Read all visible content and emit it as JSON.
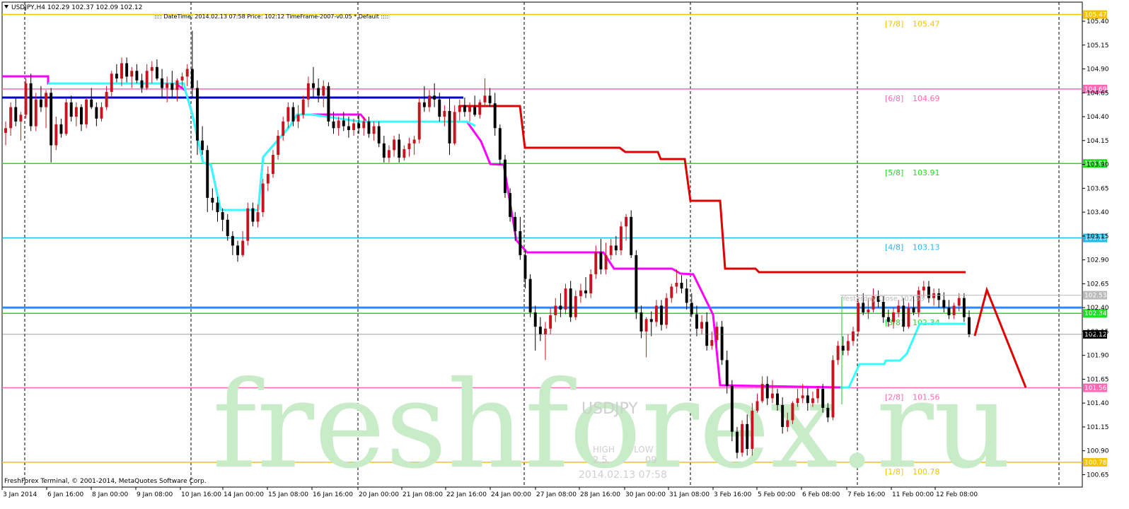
{
  "window": {
    "header": "USDJPY,H4  102.29 102.37 102.09 102.12",
    "indicator_line": ":::: DateTime: 2014.02.13 07:58    Price: 102:12    TimeFrame-2007-v0.05    *  Default    ::::",
    "copyright": "FreshForex Terminal, © 2001-2014, MetaQuotes Software Corp."
  },
  "watermark": {
    "brand": "freshforex.ru",
    "symbol": "USDJPY",
    "high_label": "HIGH",
    "low_label": "LOW",
    "high_value": "2.5",
    "low_value": "09",
    "datetime": "2014.02.13 07:58"
  },
  "colors": {
    "bull": "#c8141e",
    "bear": "#000000",
    "murrey_yellow": "#f5c400",
    "murrey_pink": "#ff69b4",
    "murrey_green": "#22dd22",
    "murrey_cyan": "#22b8e8",
    "magenta_line": "#ff00ff",
    "cyan_line": "#33ffff",
    "red_line": "#e00000",
    "blue_line": "#0000cc",
    "arrow": "#e00000",
    "watermark": "#c8ecc8"
  },
  "chart_data": {
    "type": "candlestick",
    "symbol": "USDJPY",
    "timeframe": "H4",
    "ylim": [
      100.52,
      105.6
    ],
    "y_ticks": [
      105.4,
      105.15,
      104.9,
      104.65,
      104.4,
      104.15,
      103.9,
      103.65,
      103.4,
      103.15,
      102.9,
      102.65,
      102.4,
      102.15,
      101.9,
      101.65,
      101.4,
      101.15,
      100.9,
      100.65
    ],
    "x_ticks": [
      "3 Jan 2014",
      "6 Jan 16:00",
      "8 Jan 00:00",
      "9 Jan 08:00",
      "10 Jan 16:00",
      "14 Jan 00:00",
      "15 Jan 08:00",
      "16 Jan 16:00",
      "20 Jan 00:00",
      "21 Jan 08:00",
      "22 Jan 16:00",
      "24 Jan 00:00",
      "27 Jan 08:00",
      "28 Jan 16:00",
      "30 Jan 00:00",
      "31 Jan 08:00",
      "3 Feb 16:00",
      "5 Feb 00:00",
      "6 Feb 08:00",
      "7 Feb 16:00",
      "11 Feb 00:00",
      "12 Feb 08:00"
    ],
    "current_price": "102.12",
    "murrey_levels": [
      {
        "label": "[7/8]",
        "value": "105.47",
        "color": "yellow"
      },
      {
        "label": "[6/8]",
        "value": "104.69",
        "color": "pink"
      },
      {
        "label": "[5/8]",
        "value": "103.91",
        "color": "green"
      },
      {
        "label": "[4/8]",
        "value": "103.13",
        "color": "cyan"
      },
      {
        "label": "[3/8]",
        "value": "102.34",
        "color": "green"
      },
      {
        "label": "[2/8]",
        "value": "101.56",
        "color": "pink"
      },
      {
        "label": "[1/8]",
        "value": "100.78",
        "color": "yellow"
      }
    ],
    "yesterday_close": {
      "label": "Yesterday Close 102.53",
      "value": "102.53"
    },
    "blue_line_value": 102.4,
    "upper_blue_value": 104.6,
    "candles": [
      [
        104.23,
        104.35,
        104.1,
        104.28
      ],
      [
        104.28,
        104.55,
        104.2,
        104.5
      ],
      [
        104.5,
        104.6,
        104.3,
        104.35
      ],
      [
        104.35,
        104.45,
        104.15,
        104.42
      ],
      [
        104.42,
        104.8,
        104.38,
        104.75
      ],
      [
        104.75,
        104.85,
        104.25,
        104.3
      ],
      [
        104.3,
        104.65,
        104.25,
        104.58
      ],
      [
        104.58,
        104.72,
        104.45,
        104.5
      ],
      [
        104.5,
        104.68,
        104.28,
        104.65
      ],
      [
        104.65,
        104.7,
        103.92,
        104.1
      ],
      [
        104.1,
        104.4,
        104.05,
        104.32
      ],
      [
        104.32,
        104.38,
        104.18,
        104.22
      ],
      [
        104.22,
        104.6,
        104.2,
        104.55
      ],
      [
        104.55,
        104.62,
        104.35,
        104.4
      ],
      [
        104.4,
        104.55,
        104.3,
        104.5
      ],
      [
        104.5,
        104.53,
        104.25,
        104.32
      ],
      [
        104.32,
        104.6,
        104.28,
        104.58
      ],
      [
        104.58,
        104.7,
        104.48,
        104.5
      ],
      [
        104.5,
        104.55,
        104.3,
        104.38
      ],
      [
        104.38,
        104.55,
        104.35,
        104.5
      ],
      [
        104.5,
        104.72,
        104.47,
        104.66
      ],
      [
        104.66,
        104.88,
        104.6,
        104.85
      ],
      [
        104.85,
        104.95,
        104.76,
        104.8
      ],
      [
        104.8,
        105.02,
        104.72,
        104.96
      ],
      [
        104.96,
        105.02,
        104.76,
        104.82
      ],
      [
        104.82,
        104.92,
        104.7,
        104.88
      ],
      [
        104.88,
        104.95,
        104.75,
        104.78
      ],
      [
        104.78,
        104.85,
        104.65,
        104.7
      ],
      [
        104.7,
        104.95,
        104.68,
        104.88
      ],
      [
        104.88,
        104.98,
        104.75,
        104.92
      ],
      [
        104.92,
        105.0,
        104.78,
        104.8
      ],
      [
        104.8,
        104.9,
        104.6,
        104.7
      ],
      [
        104.7,
        104.82,
        104.55,
        104.75
      ],
      [
        104.75,
        104.88,
        104.6,
        104.68
      ],
      [
        104.68,
        104.8,
        104.56,
        104.78
      ],
      [
        104.78,
        104.86,
        104.7,
        104.82
      ],
      [
        104.82,
        104.95,
        104.72,
        104.9
      ],
      [
        104.9,
        105.3,
        104.6,
        104.7
      ],
      [
        104.7,
        104.78,
        104.0,
        104.15
      ],
      [
        104.15,
        104.3,
        104.0,
        104.05
      ],
      [
        104.05,
        104.1,
        103.4,
        103.55
      ],
      [
        103.55,
        103.65,
        103.42,
        103.5
      ],
      [
        103.5,
        103.56,
        103.3,
        103.4
      ],
      [
        103.4,
        103.44,
        103.2,
        103.32
      ],
      [
        103.32,
        103.38,
        103.1,
        103.15
      ],
      [
        103.15,
        103.2,
        102.95,
        103.05
      ],
      [
        103.05,
        103.1,
        102.88,
        102.95
      ],
      [
        102.95,
        103.2,
        102.93,
        103.1
      ],
      [
        103.1,
        103.5,
        103.05,
        103.44
      ],
      [
        103.44,
        103.5,
        103.25,
        103.3
      ],
      [
        103.3,
        103.48,
        103.24,
        103.4
      ],
      [
        103.4,
        103.75,
        103.35,
        103.7
      ],
      [
        103.7,
        103.88,
        103.62,
        103.8
      ],
      [
        103.8,
        104.05,
        103.76,
        104.0
      ],
      [
        104.0,
        104.26,
        103.95,
        104.2
      ],
      [
        104.2,
        104.4,
        104.15,
        104.35
      ],
      [
        104.35,
        104.55,
        104.28,
        104.5
      ],
      [
        104.5,
        104.55,
        104.3,
        104.35
      ],
      [
        104.35,
        104.52,
        104.28,
        104.42
      ],
      [
        104.42,
        104.62,
        104.38,
        104.58
      ],
      [
        104.58,
        104.82,
        104.5,
        104.75
      ],
      [
        104.75,
        104.92,
        104.6,
        104.7
      ],
      [
        104.7,
        104.8,
        104.55,
        104.62
      ],
      [
        104.62,
        104.78,
        104.5,
        104.72
      ],
      [
        104.72,
        104.76,
        104.3,
        104.35
      ],
      [
        104.35,
        104.45,
        104.22,
        104.28
      ],
      [
        104.28,
        104.4,
        104.2,
        104.36
      ],
      [
        104.36,
        104.45,
        104.25,
        104.3
      ],
      [
        104.3,
        104.4,
        104.18,
        104.26
      ],
      [
        104.26,
        104.38,
        104.2,
        104.33
      ],
      [
        104.33,
        104.42,
        104.22,
        104.28
      ],
      [
        104.28,
        104.4,
        104.2,
        104.35
      ],
      [
        104.35,
        104.4,
        104.18,
        104.22
      ],
      [
        104.22,
        104.35,
        104.15,
        104.3
      ],
      [
        104.3,
        104.35,
        104.08,
        104.12
      ],
      [
        104.12,
        104.2,
        103.92,
        103.97
      ],
      [
        103.97,
        104.1,
        103.92,
        104.05
      ],
      [
        104.05,
        104.2,
        103.98,
        104.16
      ],
      [
        104.16,
        104.22,
        103.92,
        103.97
      ],
      [
        103.97,
        104.1,
        103.94,
        104.06
      ],
      [
        104.06,
        104.18,
        103.98,
        104.12
      ],
      [
        104.12,
        104.2,
        104.0,
        104.16
      ],
      [
        104.16,
        104.6,
        104.12,
        104.55
      ],
      [
        104.55,
        104.72,
        104.45,
        104.5
      ],
      [
        104.5,
        104.68,
        104.45,
        104.62
      ],
      [
        104.62,
        104.75,
        104.5,
        104.58
      ],
      [
        104.58,
        104.65,
        104.35,
        104.4
      ],
      [
        104.4,
        104.52,
        104.3,
        104.46
      ],
      [
        104.46,
        104.6,
        104.0,
        104.12
      ],
      [
        104.12,
        104.52,
        104.1,
        104.45
      ],
      [
        104.45,
        104.58,
        104.36,
        104.52
      ],
      [
        104.52,
        104.6,
        104.4,
        104.45
      ],
      [
        104.45,
        104.55,
        104.35,
        104.5
      ],
      [
        104.5,
        104.62,
        104.4,
        104.42
      ],
      [
        104.42,
        104.58,
        104.38,
        104.55
      ],
      [
        104.55,
        104.8,
        104.5,
        104.62
      ],
      [
        104.62,
        104.7,
        104.5,
        104.54
      ],
      [
        104.54,
        104.65,
        104.2,
        104.28
      ],
      [
        104.28,
        104.32,
        103.9,
        103.95
      ],
      [
        103.95,
        104.0,
        103.55,
        103.6
      ],
      [
        103.6,
        103.65,
        103.3,
        103.35
      ],
      [
        103.35,
        103.4,
        103.1,
        103.2
      ],
      [
        103.2,
        103.35,
        102.9,
        102.95
      ],
      [
        102.95,
        103.0,
        102.6,
        102.7
      ],
      [
        102.7,
        102.75,
        102.3,
        102.35
      ],
      [
        102.35,
        102.42,
        101.95,
        102.2
      ],
      [
        102.2,
        102.3,
        102.05,
        102.12
      ],
      [
        102.12,
        102.25,
        101.85,
        102.18
      ],
      [
        102.18,
        102.4,
        102.12,
        102.32
      ],
      [
        102.32,
        102.5,
        102.25,
        102.42
      ],
      [
        102.42,
        102.55,
        102.3,
        102.38
      ],
      [
        102.38,
        102.65,
        102.33,
        102.6
      ],
      [
        102.6,
        102.68,
        102.25,
        102.3
      ],
      [
        102.3,
        102.58,
        102.27,
        102.52
      ],
      [
        102.52,
        102.65,
        102.45,
        102.58
      ],
      [
        102.58,
        102.72,
        102.5,
        102.55
      ],
      [
        102.55,
        102.8,
        102.5,
        102.75
      ],
      [
        102.75,
        103.05,
        102.7,
        102.98
      ],
      [
        102.98,
        103.12,
        102.75,
        102.8
      ],
      [
        102.8,
        103.08,
        102.75,
        102.95
      ],
      [
        102.95,
        103.12,
        102.9,
        103.05
      ],
      [
        103.05,
        103.15,
        102.95,
        103.0
      ],
      [
        103.0,
        103.3,
        102.95,
        103.25
      ],
      [
        103.25,
        103.38,
        103.1,
        103.35
      ],
      [
        103.35,
        103.42,
        102.92,
        102.95
      ],
      [
        102.95,
        103.0,
        102.28,
        102.35
      ],
      [
        102.35,
        102.42,
        102.08,
        102.15
      ],
      [
        102.15,
        102.3,
        101.88,
        102.28
      ],
      [
        102.28,
        102.36,
        102.1,
        102.25
      ],
      [
        102.25,
        102.48,
        102.2,
        102.42
      ],
      [
        102.42,
        102.48,
        102.16,
        102.22
      ],
      [
        102.22,
        102.55,
        102.18,
        102.5
      ],
      [
        102.5,
        102.65,
        102.45,
        102.62
      ],
      [
        102.62,
        102.8,
        102.55,
        102.66
      ],
      [
        102.66,
        102.74,
        102.55,
        102.6
      ],
      [
        102.6,
        102.7,
        102.38,
        102.45
      ],
      [
        102.45,
        102.55,
        102.3,
        102.33
      ],
      [
        102.33,
        102.42,
        102.1,
        102.18
      ],
      [
        102.18,
        102.32,
        102.12,
        102.25
      ],
      [
        102.25,
        102.35,
        101.95,
        102.0
      ],
      [
        102.0,
        102.15,
        101.96,
        102.06
      ],
      [
        102.06,
        102.25,
        101.98,
        102.2
      ],
      [
        102.2,
        102.26,
        101.8,
        101.85
      ],
      [
        101.85,
        101.95,
        101.5,
        101.58
      ],
      [
        101.58,
        101.64,
        101.0,
        101.1
      ],
      [
        101.1,
        101.15,
        100.82,
        100.88
      ],
      [
        100.88,
        101.22,
        100.84,
        101.18
      ],
      [
        101.18,
        101.28,
        100.85,
        100.92
      ],
      [
        100.92,
        101.4,
        100.85,
        101.32
      ],
      [
        101.32,
        101.5,
        101.3,
        101.42
      ],
      [
        101.42,
        101.68,
        101.4,
        101.6
      ],
      [
        101.6,
        101.68,
        101.38,
        101.45
      ],
      [
        101.45,
        101.64,
        101.4,
        101.5
      ],
      [
        101.5,
        101.55,
        101.32,
        101.38
      ],
      [
        101.38,
        101.46,
        101.08,
        101.15
      ],
      [
        101.15,
        101.3,
        101.1,
        101.22
      ],
      [
        101.22,
        101.42,
        101.18,
        101.4
      ],
      [
        101.4,
        101.55,
        101.36,
        101.45
      ],
      [
        101.45,
        101.6,
        101.4,
        101.48
      ],
      [
        101.48,
        101.56,
        101.32,
        101.4
      ],
      [
        101.4,
        101.52,
        101.36,
        101.45
      ],
      [
        101.45,
        101.58,
        101.4,
        101.55
      ],
      [
        101.55,
        101.6,
        101.3,
        101.35
      ],
      [
        101.35,
        101.4,
        101.2,
        101.25
      ],
      [
        101.25,
        101.9,
        101.22,
        101.85
      ],
      [
        101.85,
        102.05,
        101.8,
        102.0
      ],
      [
        102.0,
        102.1,
        101.9,
        101.95
      ],
      [
        101.95,
        102.12,
        101.9,
        102.05
      ],
      [
        102.05,
        102.2,
        102.0,
        102.15
      ],
      [
        102.15,
        102.5,
        102.1,
        102.45
      ],
      [
        102.45,
        102.55,
        102.32,
        102.35
      ],
      [
        102.35,
        102.5,
        102.28,
        102.38
      ],
      [
        102.38,
        102.6,
        102.35,
        102.52
      ],
      [
        102.52,
        102.58,
        102.4,
        102.46
      ],
      [
        102.46,
        102.52,
        102.24,
        102.3
      ],
      [
        102.3,
        102.38,
        102.2,
        102.25
      ],
      [
        102.25,
        102.4,
        102.18,
        102.35
      ],
      [
        102.35,
        102.48,
        102.3,
        102.42
      ],
      [
        102.42,
        102.5,
        102.15,
        102.2
      ],
      [
        102.2,
        102.45,
        102.18,
        102.4
      ],
      [
        102.4,
        102.52,
        102.32,
        102.35
      ],
      [
        102.35,
        102.62,
        102.3,
        102.58
      ],
      [
        102.58,
        102.68,
        102.5,
        102.62
      ],
      [
        102.62,
        102.68,
        102.45,
        102.5
      ],
      [
        102.5,
        102.6,
        102.42,
        102.55
      ],
      [
        102.55,
        102.6,
        102.4,
        102.48
      ],
      [
        102.48,
        102.56,
        102.35,
        102.4
      ],
      [
        102.4,
        102.48,
        102.28,
        102.32
      ],
      [
        102.32,
        102.45,
        102.28,
        102.42
      ],
      [
        102.42,
        102.55,
        102.36,
        102.5
      ],
      [
        102.5,
        102.55,
        102.25,
        102.3
      ],
      [
        102.3,
        102.37,
        102.09,
        102.12
      ]
    ]
  }
}
